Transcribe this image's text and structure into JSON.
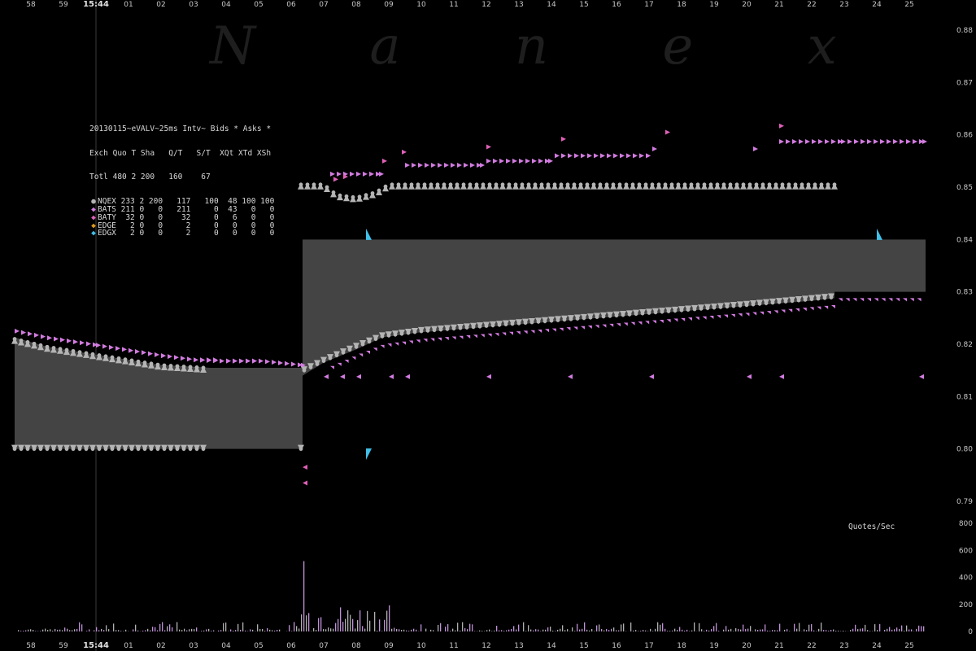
{
  "watermark": "N a n e x",
  "legend": {
    "title": "20130115~eVALV~25ms Intv~ Bids * Asks *",
    "header": "Exch Quo T Sha   Q/T   S/T  XQt XTd XSh",
    "total": "Totl 480 2 200   160    67",
    "rows": [
      {
        "exch": "NQEX",
        "text": "NQEX 233 2 200   117   100  48 100 100",
        "color": "#b4b4b4",
        "marker": "●"
      },
      {
        "exch": "BATS",
        "text": "BATS 211 0   0   211     0  43   0   0",
        "color": "#d27be0",
        "marker": "◆"
      },
      {
        "exch": "BATY",
        "text": "BATY  32 0   0    32     0   6   0   0",
        "color": "#e060b8",
        "marker": "◆"
      },
      {
        "exch": "EDGE",
        "text": "EDGE   2 0   0     2     0   0   0   0",
        "color": "#e09a20",
        "marker": "◆"
      },
      {
        "exch": "EDGX",
        "text": "EDGX   2 0   0     2     0   0   0   0",
        "color": "#40c0e8",
        "marker": "◆"
      }
    ]
  },
  "quotes_per_sec_label": "Quotes/Sec",
  "colors": {
    "background": "#000000",
    "spread_fill": "#444444",
    "nqex": "#b4b4b4",
    "bats": "#d27be0",
    "baty": "#e060b8",
    "edgx": "#40c0e8",
    "volume": "#c090d8",
    "axis_text": "#c8c8c8"
  },
  "chart_data": {
    "type": "scatter",
    "title": "20130115~eVALV~25ms Intv~ Bids * Asks *",
    "x_unit": "seconds",
    "time_ticks": [
      "58",
      "59",
      "15:44",
      "01",
      "02",
      "03",
      "04",
      "05",
      "06",
      "07",
      "08",
      "09",
      "10",
      "11",
      "12",
      "13",
      "14",
      "15",
      "16",
      "17",
      "18",
      "19",
      "20",
      "21",
      "22",
      "23",
      "24",
      "25"
    ],
    "price_axis": {
      "ticks": [
        0.79,
        0.8,
        0.81,
        0.82,
        0.83,
        0.84,
        0.85,
        0.86,
        0.87,
        0.88
      ],
      "ylim": [
        0.79,
        0.883
      ]
    },
    "qps_axis": {
      "ticks": [
        0,
        200,
        400,
        600,
        800
      ],
      "ylim": [
        0,
        800
      ],
      "label": "Quotes/Sec"
    },
    "nbbo_spread": [
      {
        "t": -2.5,
        "bid": 0.8,
        "ask": 0.8213
      },
      {
        "t": -1.5,
        "bid": 0.8,
        "ask": 0.8195
      },
      {
        "t": 0.0,
        "bid": 0.8,
        "ask": 0.818
      },
      {
        "t": 1.0,
        "bid": 0.8,
        "ask": 0.817
      },
      {
        "t": 2.0,
        "bid": 0.8,
        "ask": 0.816
      },
      {
        "t": 3.0,
        "bid": 0.8,
        "ask": 0.8157
      },
      {
        "t": 3.5,
        "bid": 0.8,
        "ask": 0.8155
      },
      {
        "t": 6.35,
        "bid": 0.8,
        "ask": 0.8155
      },
      {
        "t": 6.35,
        "bid": 0.814,
        "ask": 0.84
      },
      {
        "t": 7.0,
        "bid": 0.8165,
        "ask": 0.84
      },
      {
        "t": 8.0,
        "bid": 0.819,
        "ask": 0.84
      },
      {
        "t": 8.8,
        "bid": 0.8213,
        "ask": 0.84
      },
      {
        "t": 10.0,
        "bid": 0.8223,
        "ask": 0.84
      },
      {
        "t": 12.0,
        "bid": 0.8233,
        "ask": 0.84
      },
      {
        "t": 14.0,
        "bid": 0.8243,
        "ask": 0.84
      },
      {
        "t": 16.0,
        "bid": 0.8253,
        "ask": 0.84
      },
      {
        "t": 18.0,
        "bid": 0.8263,
        "ask": 0.84
      },
      {
        "t": 20.0,
        "bid": 0.8273,
        "ask": 0.84
      },
      {
        "t": 22.0,
        "bid": 0.8283,
        "ask": 0.84
      },
      {
        "t": 22.7,
        "bid": 0.8288,
        "ask": 0.84
      },
      {
        "t": 22.7,
        "bid": 0.83,
        "ask": 0.84
      },
      {
        "t": 25.5,
        "bid": 0.83,
        "ask": 0.84
      }
    ],
    "series": [
      {
        "name": "NQEX",
        "side": "bid",
        "segments": [
          {
            "t0": -2.5,
            "t1": 3.3,
            "p0": 0.8,
            "p1": 0.8
          },
          {
            "t0": 6.3,
            "t1": 6.4,
            "p0": 0.8,
            "p1": 0.8
          },
          {
            "t0": 6.3,
            "t1": 22.7,
            "curve": "rising",
            "points": [
              [
                6.4,
                0.815
              ],
              [
                7.0,
                0.8168
              ],
              [
                8.0,
                0.8195
              ],
              [
                8.8,
                0.8215
              ],
              [
                10,
                0.8225
              ],
              [
                12,
                0.8235
              ],
              [
                14,
                0.8245
              ],
              [
                16,
                0.8255
              ],
              [
                18,
                0.8265
              ],
              [
                20,
                0.8275
              ],
              [
                22.7,
                0.829
              ]
            ]
          }
        ]
      },
      {
        "name": "NQEX",
        "side": "ask",
        "segments": [
          {
            "t0": -2.5,
            "t1": 3.3,
            "curve": "falling",
            "points": [
              [
                -2.5,
                0.821
              ],
              [
                -1.5,
                0.8195
              ],
              [
                0,
                0.818
              ],
              [
                1,
                0.817
              ],
              [
                2,
                0.816
              ],
              [
                3.3,
                0.8155
              ]
            ]
          },
          {
            "t0": 6.3,
            "t1": 22.7,
            "curve": "flat-with-dip",
            "points": [
              [
                6.3,
                0.8505
              ],
              [
                7.0,
                0.8505
              ],
              [
                7.4,
                0.8485
              ],
              [
                8.0,
                0.848
              ],
              [
                8.6,
                0.849
              ],
              [
                9.0,
                0.8505
              ],
              [
                22.7,
                0.8505
              ]
            ]
          }
        ]
      },
      {
        "name": "BATS",
        "side": "bid",
        "points": [
          [
            7,
            0.8138
          ],
          [
            7.5,
            0.8138
          ],
          [
            8.0,
            0.8138
          ],
          [
            9.0,
            0.8138
          ],
          [
            9.5,
            0.8138
          ],
          [
            12,
            0.8138
          ],
          [
            14.5,
            0.8138
          ],
          [
            17,
            0.8138
          ],
          [
            20,
            0.8138
          ],
          [
            21,
            0.8138
          ],
          [
            25.3,
            0.8138
          ]
        ]
      },
      {
        "name": "BATS",
        "side": "ask",
        "points": [
          [
            -2.5,
            0.8225
          ],
          [
            -1.5,
            0.8212
          ],
          [
            0,
            0.8198
          ],
          [
            1,
            0.8188
          ],
          [
            2,
            0.8178
          ],
          [
            3,
            0.817
          ],
          [
            3.8,
            0.8168
          ],
          [
            5,
            0.8168
          ],
          [
            6.3,
            0.816
          ],
          [
            7.2,
            0.8525
          ],
          [
            8.7,
            0.8525
          ],
          [
            9.5,
            0.8542
          ],
          [
            11.8,
            0.8542
          ],
          [
            12,
            0.855
          ],
          [
            13.9,
            0.855
          ],
          [
            14.1,
            0.856
          ],
          [
            16.9,
            0.856
          ],
          [
            17.1,
            0.8573
          ],
          [
            20.2,
            0.8573
          ],
          [
            21.0,
            0.8587
          ],
          [
            22.9,
            0.8587
          ],
          [
            23.5,
            0.8587
          ],
          [
            25.4,
            0.8587
          ]
        ]
      },
      {
        "name": "BATY",
        "side": "bid",
        "points": [
          [
            6.35,
            0.7935
          ],
          [
            6.35,
            0.7965
          ]
        ]
      },
      {
        "name": "BATY",
        "side": "ask",
        "points": [
          [
            7.3,
            0.8515
          ],
          [
            7.6,
            0.852
          ],
          [
            8.8,
            0.855
          ],
          [
            9.4,
            0.8567
          ],
          [
            12,
            0.8577
          ],
          [
            14.3,
            0.8592
          ],
          [
            17.5,
            0.8605
          ],
          [
            21.0,
            0.8617
          ]
        ]
      },
      {
        "name": "EDGX",
        "side": "bid",
        "points": [
          [
            8.3,
            0.799
          ],
          [
            24.0,
            0.841
          ]
        ]
      },
      {
        "name": "EDGX",
        "side": "ask",
        "points": [
          [
            8.3,
            0.841
          ]
        ]
      }
    ],
    "quote_rate": {
      "spike": {
        "t": 6.35,
        "value": 520
      },
      "burst_window": [
        6.3,
        9.0
      ],
      "burst_max": 200,
      "baseline_max": 70
    }
  }
}
